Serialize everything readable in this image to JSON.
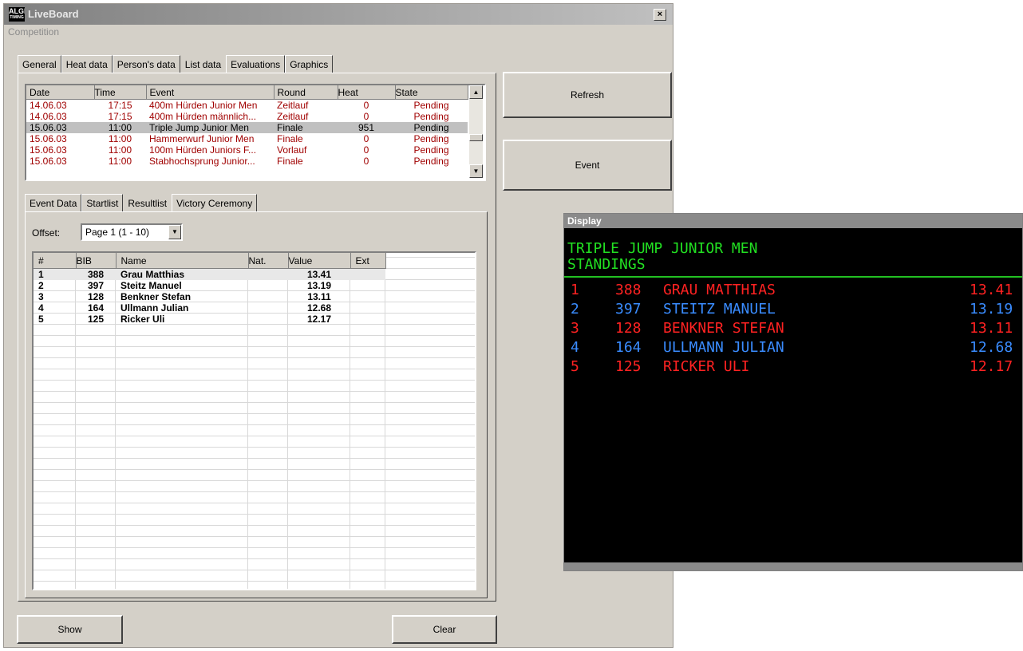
{
  "window": {
    "title": "LiveBoard",
    "logo_text": "ALGE",
    "logo_sub": "TIMING",
    "close": "×",
    "menu": "Competition"
  },
  "top_tabs": [
    "General",
    "Heat data",
    "Person's data",
    "List data",
    "Evaluations",
    "Graphics"
  ],
  "event_list": {
    "columns": [
      "Date",
      "Time",
      "Event",
      "Round",
      "Heat",
      "State"
    ],
    "rows": [
      {
        "date": "14.06.03",
        "time": "17:15",
        "event": "400m Hürden Junior Men",
        "round": "Zeitlauf",
        "heat": "0",
        "state": "Pending",
        "style": "pending"
      },
      {
        "date": "14.06.03",
        "time": "17:15",
        "event": "400m Hürden männlich...",
        "round": "Zeitlauf",
        "heat": "0",
        "state": "Pending",
        "style": "pending"
      },
      {
        "date": "15.06.03",
        "time": "11:00",
        "event": "Triple Jump Junior Men",
        "round": "Finale",
        "heat": "951",
        "state": "Pending",
        "style": "selected"
      },
      {
        "date": "15.06.03",
        "time": "11:00",
        "event": "Hammerwurf Junior Men",
        "round": "Finale",
        "heat": "0",
        "state": "Pending",
        "style": "pending"
      },
      {
        "date": "15.06.03",
        "time": "11:00",
        "event": "100m Hürden Juniors F...",
        "round": "Vorlauf",
        "heat": "0",
        "state": "Pending",
        "style": "pending"
      },
      {
        "date": "15.06.03",
        "time": "11:00",
        "event": "Stabhochsprung Junior...",
        "round": "Finale",
        "heat": "0",
        "state": "Pending",
        "style": "pending"
      }
    ]
  },
  "sub_tabs": [
    "Event Data",
    "Startlist",
    "Resultlist",
    "Victory Ceremony"
  ],
  "offset": {
    "label": "Offset:",
    "value": "Page 1 (1 - 10)"
  },
  "results": {
    "columns": [
      "#",
      "BIB",
      "Name",
      "Nat.",
      "Value",
      "Ext"
    ],
    "rows": [
      {
        "rank": "1",
        "bib": "388",
        "name": "Grau Matthias",
        "nat": "",
        "value": "13.41",
        "ext": ""
      },
      {
        "rank": "2",
        "bib": "397",
        "name": "Steitz Manuel",
        "nat": "",
        "value": "13.19",
        "ext": ""
      },
      {
        "rank": "3",
        "bib": "128",
        "name": "Benkner Stefan",
        "nat": "",
        "value": "13.11",
        "ext": ""
      },
      {
        "rank": "4",
        "bib": "164",
        "name": "Ullmann Julian",
        "nat": "",
        "value": "12.68",
        "ext": ""
      },
      {
        "rank": "5",
        "bib": "125",
        "name": "Ricker Uli",
        "nat": "",
        "value": "12.17",
        "ext": ""
      }
    ]
  },
  "buttons": {
    "refresh": "Refresh",
    "event": "Event",
    "show": "Show",
    "clear": "Clear"
  },
  "display": {
    "title": "Display",
    "line1": "TRIPLE JUMP JUNIOR MEN",
    "line2": "STANDINGS",
    "rows": [
      {
        "rank": "1",
        "bib": "388",
        "name": "GRAU MATTHIAS",
        "value": "13.41",
        "color": "red"
      },
      {
        "rank": "2",
        "bib": "397",
        "name": "STEITZ MANUEL",
        "value": "13.19",
        "color": "blue"
      },
      {
        "rank": "3",
        "bib": "128",
        "name": "BENKNER STEFAN",
        "value": "13.11",
        "color": "red"
      },
      {
        "rank": "4",
        "bib": "164",
        "name": "ULLMANN JULIAN",
        "value": "12.68",
        "color": "blue"
      },
      {
        "rank": "5",
        "bib": "125",
        "name": "RICKER ULI",
        "value": "12.17",
        "color": "red"
      }
    ]
  },
  "colors": {
    "pending": "#a00000",
    "led_green": "#22e022",
    "led_red": "#ff2222",
    "led_blue": "#3a8cff"
  }
}
